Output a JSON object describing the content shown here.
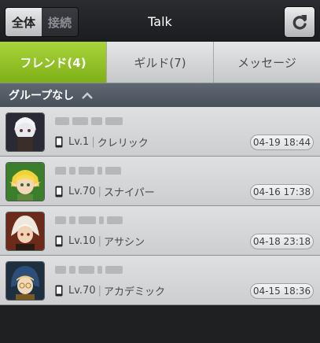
{
  "topbar": {
    "segment_all": "全体",
    "segment_connected": "接続",
    "title": "Talk"
  },
  "tabs": [
    {
      "label": "フレンド(4)"
    },
    {
      "label": "ギルド(7)"
    },
    {
      "label": "メッセージ"
    }
  ],
  "group": {
    "label": "グループなし"
  },
  "friends": [
    {
      "level": "Lv.1",
      "class": "クレリック",
      "date": "04-19 18:44"
    },
    {
      "level": "Lv.70",
      "class": "スナイパー",
      "date": "04-16 17:38"
    },
    {
      "level": "Lv.10",
      "class": "アサシン",
      "date": "04-18 23:18"
    },
    {
      "level": "Lv.70",
      "class": "アカデミック",
      "date": "04-15 18:36"
    }
  ],
  "colors": {
    "accent": "#8fbf24"
  }
}
